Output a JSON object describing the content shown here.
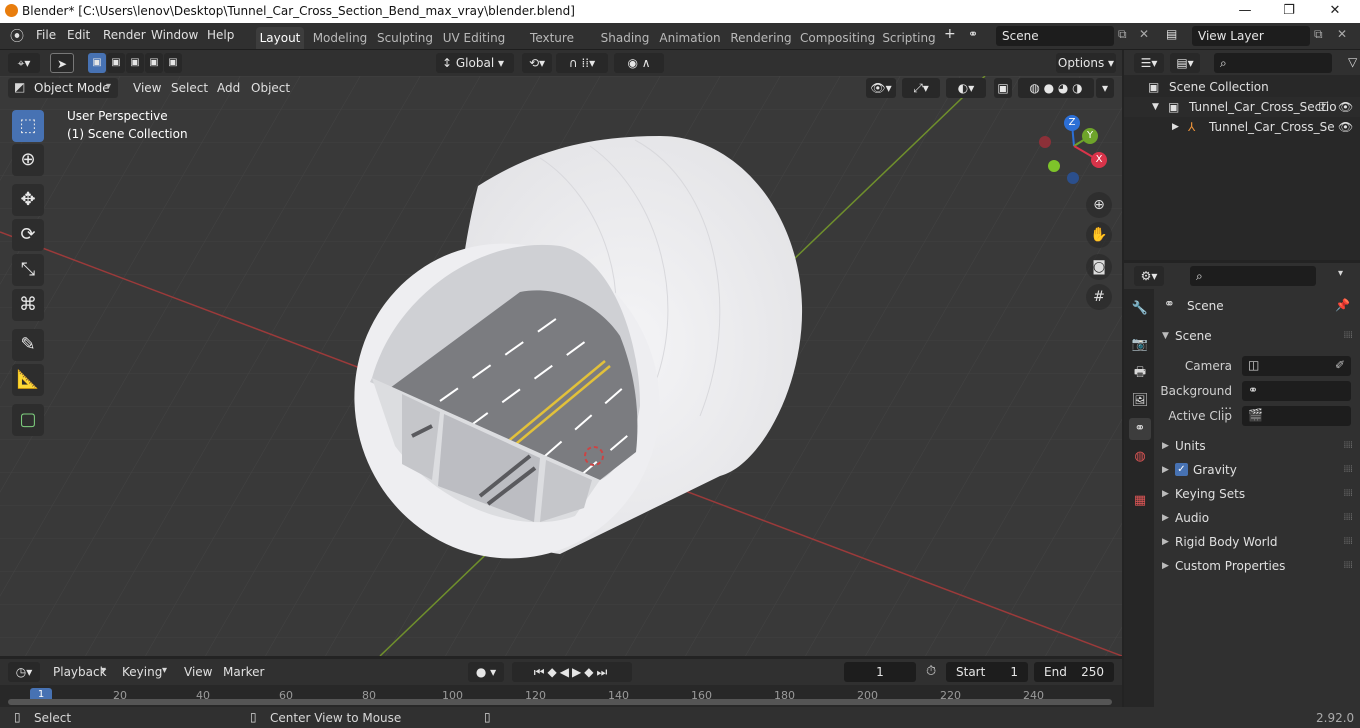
{
  "window": {
    "title": "Blender* [C:\\Users\\lenov\\Desktop\\Tunnel_Car_Cross_Section_Bend_max_vray\\blender.blend]",
    "minimize": "—",
    "maximize": "❐",
    "close": "✕"
  },
  "menubar": {
    "items": [
      "File",
      "Edit",
      "Render",
      "Window",
      "Help"
    ]
  },
  "workspaces": [
    "Layout",
    "Modeling",
    "Sculpting",
    "UV Editing",
    "Texture Paint",
    "Shading",
    "Animation",
    "Rendering",
    "Compositing",
    "Scripting"
  ],
  "active_workspace": "Layout",
  "scene_selector": "Scene",
  "view_layer_selector": "View Layer",
  "viewport_header": {
    "transform_orientation": "Global",
    "options_label": "Options",
    "mode": "Object Mode",
    "menus": [
      "View",
      "Select",
      "Add",
      "Object"
    ]
  },
  "viewport": {
    "perspective_label": "User Perspective",
    "collection_label": "(1) Scene Collection",
    "gizmo_x": "X",
    "gizmo_y": "Y",
    "gizmo_z": "Z"
  },
  "icons": {
    "select": "select-box-icon",
    "cursor": "cursor-icon",
    "move": "move-icon",
    "rotate": "rotate-icon",
    "scale": "scale-icon",
    "transform": "transform-icon",
    "annotate": "annotate-icon",
    "measure": "measure-icon",
    "add_cube": "add-cube-icon"
  },
  "outliner": {
    "root": "Scene Collection",
    "items": [
      {
        "label": "Tunnel_Car_Cross_Sectio",
        "depth": 1
      },
      {
        "label": "Tunnel_Car_Cross_Se",
        "depth": 2
      }
    ]
  },
  "properties": {
    "context_name": "Scene",
    "section_title": "Scene",
    "fields": [
      {
        "label": "Camera"
      },
      {
        "label": "Background ..."
      },
      {
        "label": "Active Clip"
      }
    ],
    "panels": [
      "Units",
      "Gravity",
      "Keying Sets",
      "Audio",
      "Rigid Body World",
      "Custom Properties"
    ],
    "gravity_checked": true
  },
  "timeline": {
    "menus": [
      "Playback",
      "Keying",
      "View",
      "Marker"
    ],
    "current_frame": "1",
    "start_label": "Start",
    "start_value": "1",
    "end_label": "End",
    "end_value": "250",
    "ticks": [
      "1",
      "20",
      "40",
      "60",
      "80",
      "100",
      "120",
      "140",
      "160",
      "180",
      "200",
      "220",
      "240"
    ]
  },
  "statusbar": {
    "left": "Select",
    "middle": "Center View to Mouse",
    "version": "2.92.0"
  }
}
